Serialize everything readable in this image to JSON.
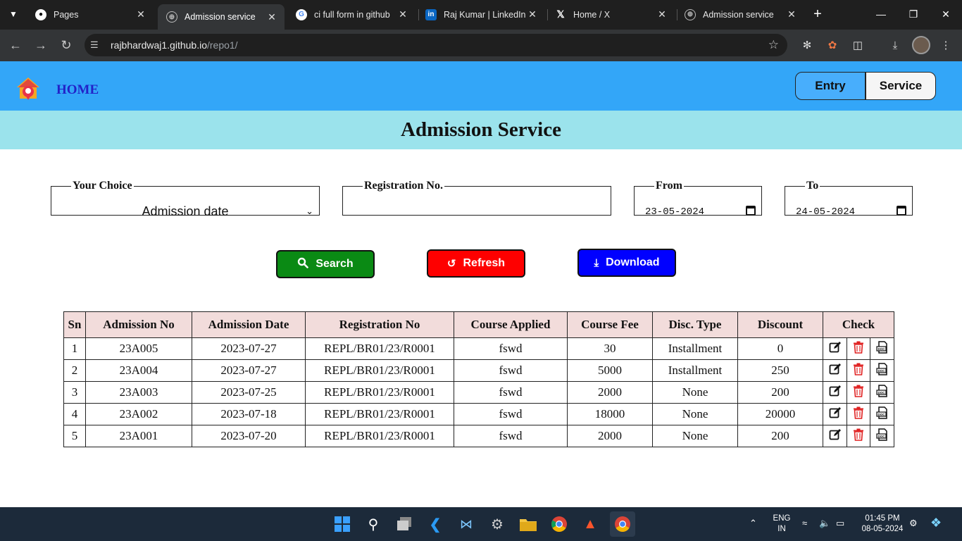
{
  "browser": {
    "tabs": [
      {
        "label": "Pages",
        "favicon": "github-icon",
        "active": false
      },
      {
        "label": "Admission service",
        "favicon": "globe-icon",
        "active": true
      },
      {
        "label": "ci full form in github",
        "favicon": "google-icon",
        "active": false
      },
      {
        "label": "Raj Kumar | LinkedIn",
        "favicon": "linkedin-icon",
        "active": false
      },
      {
        "label": "Home / X",
        "favicon": "x-icon",
        "active": false
      },
      {
        "label": "Admission service",
        "favicon": "globe-icon",
        "active": false
      }
    ],
    "url_host": "rajbhardwaj1.github.io",
    "url_path": "/repo1/"
  },
  "header": {
    "home_label": "HOME",
    "entry_label": "Entry",
    "service_label": "Service"
  },
  "page": {
    "title": "Admission Service"
  },
  "filters": {
    "choice_legend": "Your Choice",
    "choice_value": "Admission date",
    "registration_legend": "Registration No.",
    "registration_value": "",
    "from_legend": "From",
    "from_value": "23-05-2024",
    "to_legend": "To",
    "to_value": "24-05-2024"
  },
  "actions": {
    "search_label": "Search",
    "refresh_label": "Refresh",
    "download_label": "Download"
  },
  "table": {
    "headers": [
      "Sn",
      "Admission No",
      "Admission Date",
      "Registration No",
      "Course Applied",
      "Course Fee",
      "Disc. Type",
      "Discount",
      "Check"
    ],
    "rows": [
      [
        "1",
        "23A005",
        "2023-07-27",
        "REPL/BR01/23/R0001",
        "fswd",
        "30",
        "Installment",
        "0"
      ],
      [
        "2",
        "23A004",
        "2023-07-27",
        "REPL/BR01/23/R0001",
        "fswd",
        "5000",
        "Installment",
        "250"
      ],
      [
        "3",
        "23A003",
        "2023-07-25",
        "REPL/BR01/23/R0001",
        "fswd",
        "2000",
        "None",
        "200"
      ],
      [
        "4",
        "23A002",
        "2023-07-18",
        "REPL/BR01/23/R0001",
        "fswd",
        "18000",
        "None",
        "20000"
      ],
      [
        "5",
        "23A001",
        "2023-07-20",
        "REPL/BR01/23/R0001",
        "fswd",
        "2000",
        "None",
        "200"
      ]
    ]
  },
  "taskbar": {
    "lang_line1": "ENG",
    "lang_line2": "IN",
    "time": "01:45 PM",
    "date": "08-05-2024"
  },
  "colors": {
    "header_bg": "#33a6f8",
    "title_band_bg": "#9be3ec",
    "search_btn": "#0a8a14",
    "refresh_btn": "#fe0000",
    "download_btn": "#0000ff",
    "table_header_bg": "#f2dcdb"
  }
}
